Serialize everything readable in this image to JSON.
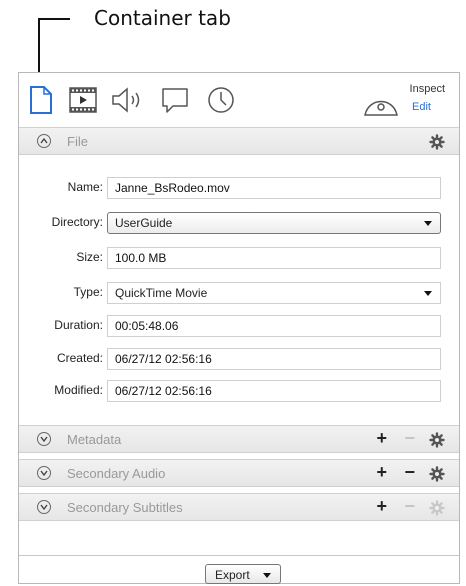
{
  "callout": {
    "label": "Container tab"
  },
  "toolbar": {
    "tabs": [
      {
        "icon": "document-icon",
        "active": true
      },
      {
        "icon": "film-icon",
        "active": false
      },
      {
        "icon": "speaker-icon",
        "active": false
      },
      {
        "icon": "speech-bubble-icon",
        "active": false
      },
      {
        "icon": "clock-icon",
        "active": false
      }
    ],
    "inspect_label": "Inspect",
    "edit_label": "Edit"
  },
  "file_section": {
    "label": "File",
    "expanded": true
  },
  "fields": {
    "name": {
      "label": "Name:",
      "value": "Janne_BsRodeo.mov"
    },
    "directory": {
      "label": "Directory:",
      "value": "UserGuide"
    },
    "size": {
      "label": "Size:",
      "value": "100.0 MB"
    },
    "type": {
      "label": "Type:",
      "value": "QuickTime Movie"
    },
    "duration": {
      "label": "Duration:",
      "value": "00:05:48.06"
    },
    "created": {
      "label": "Created:",
      "value": "06/27/12 02:56:16"
    },
    "modified": {
      "label": "Modified:",
      "value": "06/27/12 02:56:16"
    }
  },
  "sections": [
    {
      "label": "Metadata",
      "plus": "+",
      "minus": "−",
      "minus_enabled": false,
      "gear_enabled": true
    },
    {
      "label": "Secondary Audio",
      "plus": "+",
      "minus": "−",
      "minus_enabled": true,
      "gear_enabled": true
    },
    {
      "label": "Secondary Subtitles",
      "plus": "+",
      "minus": "−",
      "minus_enabled": false,
      "gear_enabled": false
    }
  ],
  "footer": {
    "export_label": "Export"
  },
  "colors": {
    "accent": "#2a6fd6",
    "disabled": "#c4c4c4",
    "section_bg": "#ececec"
  }
}
